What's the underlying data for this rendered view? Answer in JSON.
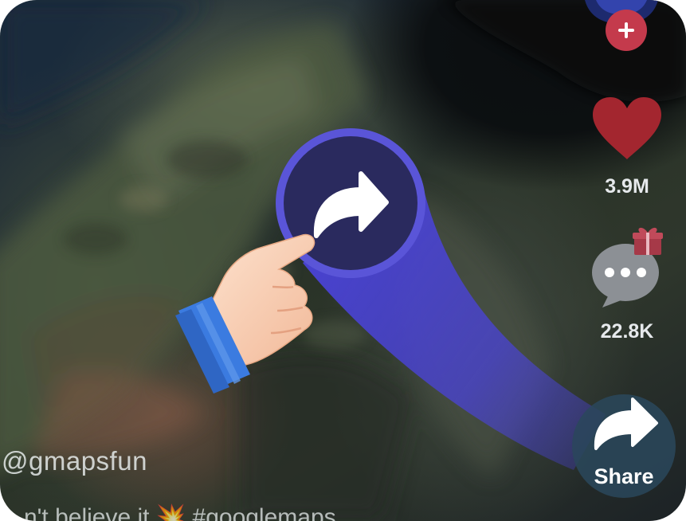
{
  "video": {
    "author_handle": "@gmapsfun",
    "caption": "n't believe it 💥 #googlemaps"
  },
  "actions": {
    "like_count": "3.9M",
    "comment_count": "22.8K",
    "share_label": "Share"
  },
  "overlay": {
    "highlight_color": "#5a55d8",
    "cuff_color": "#3b7be0"
  },
  "icons": {
    "follow": "plus-icon",
    "like": "heart-icon",
    "comment": "speech-bubble-icon",
    "gift": "gift-icon",
    "share": "share-arrow-icon",
    "pointer": "pointing-hand-icon"
  }
}
